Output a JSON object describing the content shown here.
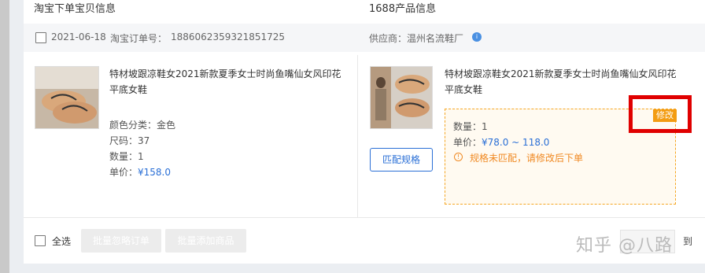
{
  "headers": {
    "taobao": "淘宝下单宝贝信息",
    "ali1688": "1688产品信息"
  },
  "order": {
    "date": "2021-06-18",
    "order_label": "淘宝订单号：",
    "order_no": "1886062359321851725",
    "supplier_label": "供应商：",
    "supplier_name": "温州名流鞋厂",
    "info_badge": "i"
  },
  "taobao_item": {
    "title": "特材坡跟凉鞋女2021新款夏季女士时尚鱼嘴仙女风印花平底女鞋",
    "attrs": {
      "color": "颜色分类：金色",
      "size": "尺码：37",
      "quantity": "数量：1",
      "price_label": "单价：",
      "price_value": "¥158.0"
    }
  },
  "ali_item": {
    "title": "特材坡跟凉鞋女2021新款夏季女士时尚鱼嘴仙女风印花平底女鞋",
    "match_button": "匹配规格",
    "quantity": "数量：1",
    "price_label": "单价：",
    "price_range": "¥78.0 ~ 118.0",
    "warning": "规格未匹配，请修改后下单",
    "edit_label": "修改"
  },
  "footer": {
    "select_all": "全选",
    "batch_ignore": "批量忽略订单",
    "batch_add": "批量添加商品",
    "watermark": "知乎 @八路",
    "cut_text": "到"
  },
  "icons": {
    "info": "info-circle-icon",
    "warning": "warning-circle-icon",
    "checkbox": "checkbox-icon"
  },
  "colors": {
    "accent_blue": "#2a6fd6",
    "warning_orange": "#f39c12",
    "highlight_red": "#e00000"
  }
}
